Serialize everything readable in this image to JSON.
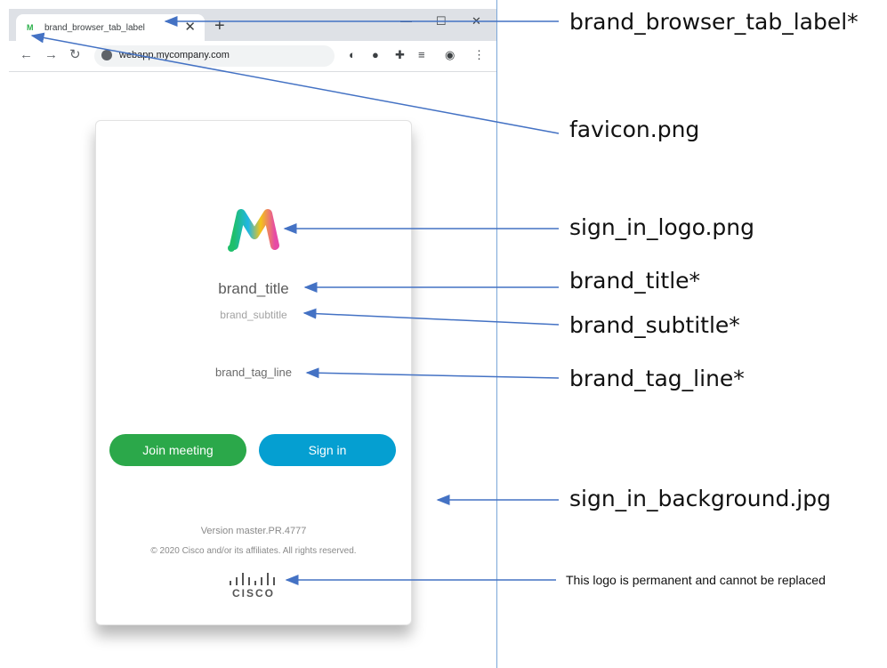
{
  "browser": {
    "tab_favicon": "M",
    "tab_label": "brand_browser_tab_label",
    "tab_close": "✕",
    "new_tab": "+",
    "minimize": "—",
    "maximize": "☐",
    "close": "✕",
    "back": "←",
    "forward": "→",
    "reload": "↻",
    "url": "webapp.mycompany.com"
  },
  "card": {
    "brand_title": "brand_title",
    "brand_subtitle": "brand_subtitle",
    "brand_tag_line": "brand_tag_line",
    "join_button": "Join meeting",
    "sign_in_button": "Sign in",
    "version": "Version master.PR.4777",
    "copyright": "© 2020 Cisco and/or its affiliates. All rights reserved.",
    "cisco_wordmark": "CISCO"
  },
  "annotations": {
    "tab_label": "brand_browser_tab_label*",
    "favicon": "favicon.png",
    "logo": "sign_in_logo.png",
    "title": "brand_title*",
    "subtitle": "brand_subtitle*",
    "tag_line": "brand_tag_line*",
    "background": "sign_in_background.jpg",
    "cisco_note": "This logo is permanent and cannot be replaced"
  },
  "colors": {
    "arrow": "#4472c4",
    "join_button": "#2ba84a",
    "sign_in_button": "#059fd1"
  }
}
